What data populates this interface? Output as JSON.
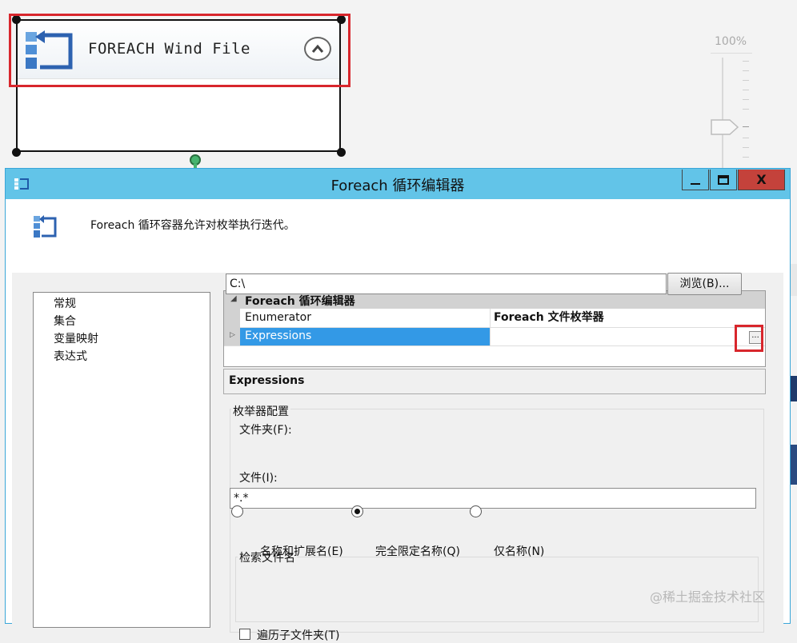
{
  "canvas": {
    "container_title": "FOREACH Wind File",
    "zoom_level": "100%"
  },
  "dialog": {
    "title": "Foreach 循环编辑器",
    "close_glyph": "X",
    "description": "Foreach 循环容器允许对枚举执行迭代。",
    "nav_items": [
      "常规",
      "集合",
      "变量映射",
      "表达式"
    ],
    "property_grid": {
      "category": "Foreach 循环编辑器",
      "rows": [
        {
          "name": "Enumerator",
          "value": "Foreach 文件枚举器"
        },
        {
          "name": "Expressions",
          "value": ""
        }
      ],
      "ellipsis_label": "..."
    },
    "description_panel_title": "Expressions",
    "enumerator_config": {
      "group_label": "枚举器配置",
      "folder_label": "文件夹(F):",
      "folder_value": "C:\\",
      "browse_label": "浏览(B)...",
      "files_label": "文件(I):",
      "files_value": "*.*",
      "retrieve_label": "检索文件名",
      "options": [
        {
          "label": "名称和扩展名(E)",
          "checked": false
        },
        {
          "label": "完全限定名称(Q)",
          "checked": true
        },
        {
          "label": "仅名称(N)",
          "checked": false
        }
      ],
      "traverse_label": "遍历子文件夹(T)",
      "traverse_checked": false
    }
  },
  "watermark": "@稀土掘金技术社区",
  "colors": {
    "titlebar": "#62c4e8",
    "close_button": "#c4423b",
    "highlight": "#d8262c",
    "selection": "#3399e6"
  }
}
